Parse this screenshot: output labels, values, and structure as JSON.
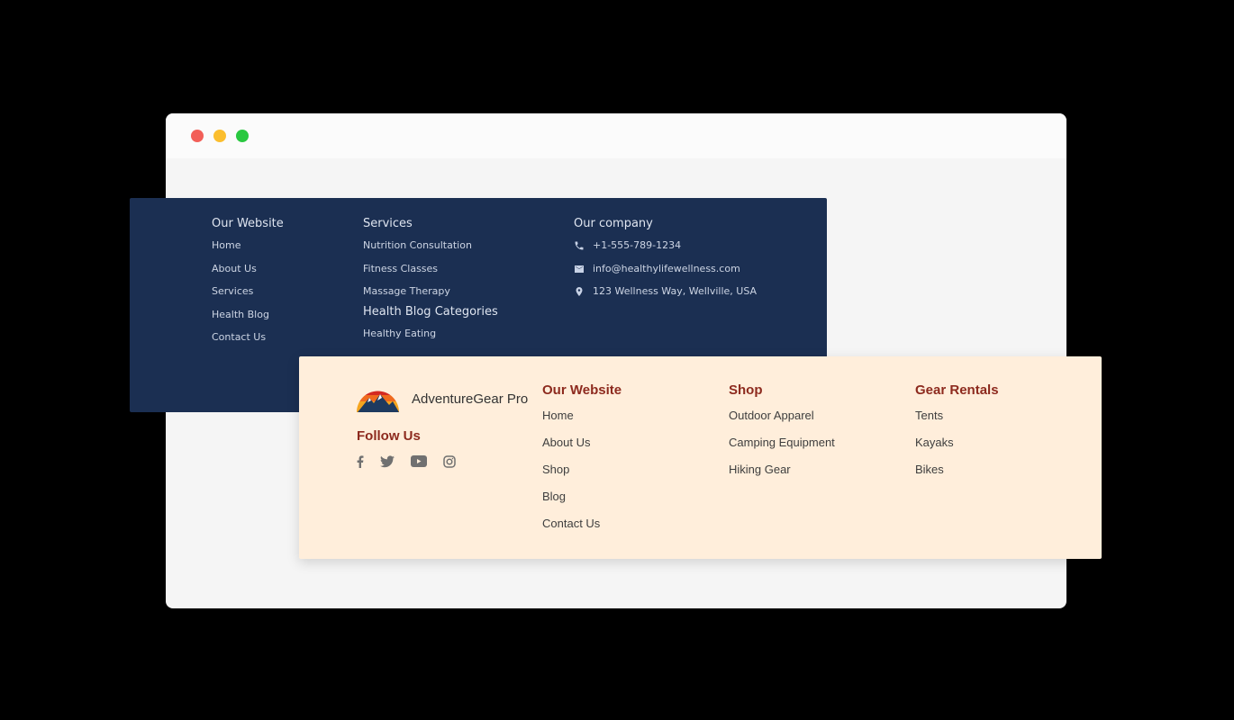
{
  "window": {
    "controls": {
      "close": "#f25f58",
      "minimize": "#fbbe2e",
      "maximize": "#29c840"
    }
  },
  "wellness_footer": {
    "bg": "#1b2f52",
    "our_website": {
      "heading": "Our Website",
      "items": [
        "Home",
        "About Us",
        "Services",
        "Health Blog",
        "Contact Us"
      ]
    },
    "services": {
      "heading": "Services",
      "items": [
        "Nutrition Consultation",
        "Fitness Classes",
        "Massage Therapy"
      ]
    },
    "blog_categories": {
      "heading": "Health Blog Categories",
      "items": [
        "Healthy Eating"
      ]
    },
    "company": {
      "heading": "Our company",
      "phone": "+1-555-789-1234",
      "email": "info@healthylifewellness.com",
      "address": "123 Wellness Way, Wellville, USA"
    }
  },
  "adventure_footer": {
    "bg": "#ffeedb",
    "accent": "#8d2a1e",
    "brand": "AdventureGear Pro",
    "follow_heading": "Follow Us",
    "social": [
      "facebook-icon",
      "twitter-icon",
      "youtube-icon",
      "instagram-icon"
    ],
    "our_website": {
      "heading": "Our Website",
      "items": [
        "Home",
        "About Us",
        "Shop",
        "Blog",
        "Contact Us"
      ]
    },
    "shop": {
      "heading": "Shop",
      "items": [
        "Outdoor Apparel",
        "Camping Equipment",
        "Hiking Gear"
      ]
    },
    "rentals": {
      "heading": "Gear Rentals",
      "items": [
        "Tents",
        "Kayaks",
        "Bikes"
      ]
    }
  }
}
